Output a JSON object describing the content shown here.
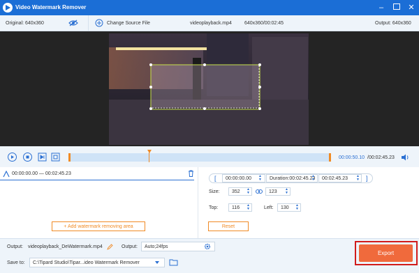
{
  "window": {
    "title": "Video Watermark Remover"
  },
  "infobar": {
    "original_label": "Original: 640x360",
    "change_source_label": "Change Source File",
    "filename": "videoplayback.mp4",
    "meta": "640x360/00:02:45",
    "output_label": "Output: 640x360"
  },
  "controls": {
    "current_time": "00:00:50.10",
    "total_time": "/00:02:45.23"
  },
  "segment": {
    "range": "00:00:00.00 — 00:02:45.23"
  },
  "add_area_label": "Add watermark removing area",
  "rightpanel": {
    "start_time": "00:00:00.00",
    "duration_label": "Duration:00:02:45.23",
    "end_time": "00:02:45.23",
    "size_label": "Size:",
    "width": "352",
    "height": "123",
    "top_label": "Top:",
    "top": "116",
    "left_label": "Left:",
    "left": "130",
    "reset_label": "Reset"
  },
  "bottom": {
    "output_label": "Output:",
    "output_name": "videoplayback_DeWatermark.mp4",
    "output2_label": "Output:",
    "output_format": "Auto;24fps",
    "saveto_label": "Save to:",
    "save_path": "C:\\Tipard Studio\\Tipar...ideo Watermark Remover",
    "export_label": "Export"
  },
  "colors": {
    "titlebar": "#1b6ed6",
    "accent": "#2a6fd2",
    "orange": "#f08a24",
    "export": "#f06a3c",
    "highlight": "#d11b1b"
  }
}
